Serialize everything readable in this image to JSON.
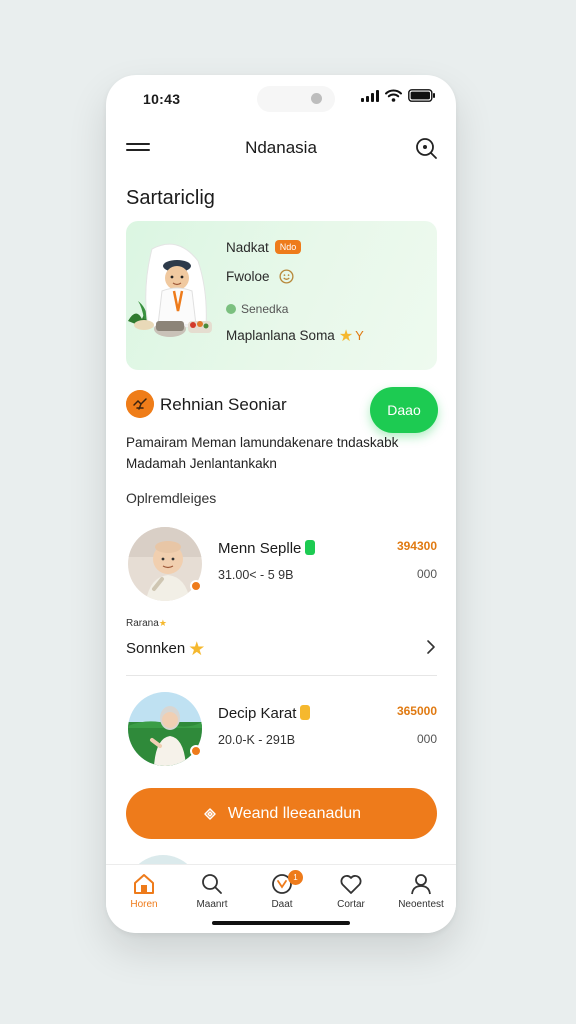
{
  "status_bar": {
    "time": "10:43"
  },
  "header": {
    "title": "Ndanasia"
  },
  "section_title": "Sartariclig",
  "hero_card": {
    "line1": "Nadkat",
    "line1_tag": "Ndo",
    "line2": "Fwoloe",
    "line3": "Senedka",
    "line4": "Maplanlana Soma",
    "line4_suffix": "Y"
  },
  "feature": {
    "title": "Rehnian Seoniar",
    "button_label": "Daao"
  },
  "description": "Pamairam Meman lamundakenare tndaskabk Madamah Jenlantankakn",
  "sub_heading": "Oplremdleiges",
  "listings": [
    {
      "name": "Menn Seplle",
      "range": "31.00< - 5 9B",
      "price": "394300",
      "count": "000",
      "badge_color": "#1dcb52"
    },
    {
      "name": "Decip Karat",
      "range": "20.0-K - 291B",
      "price": "365000",
      "count": "000",
      "badge_color": "#f5b82e"
    }
  ],
  "small_label": "Rarana",
  "sponsor_text": "Sonnken",
  "cta": {
    "label": "Weand lleeanadun"
  },
  "tabs": [
    {
      "label": "Horen",
      "active": true
    },
    {
      "label": "Maanrt",
      "active": false
    },
    {
      "label": "Daat",
      "active": false,
      "badge": "1"
    },
    {
      "label": "Cortar",
      "active": false
    },
    {
      "label": "Neoentest",
      "active": false
    }
  ],
  "colors": {
    "accent_orange": "#ee7b1b",
    "accent_green": "#1dcb52",
    "hero_bg": "#dbf6e2"
  }
}
